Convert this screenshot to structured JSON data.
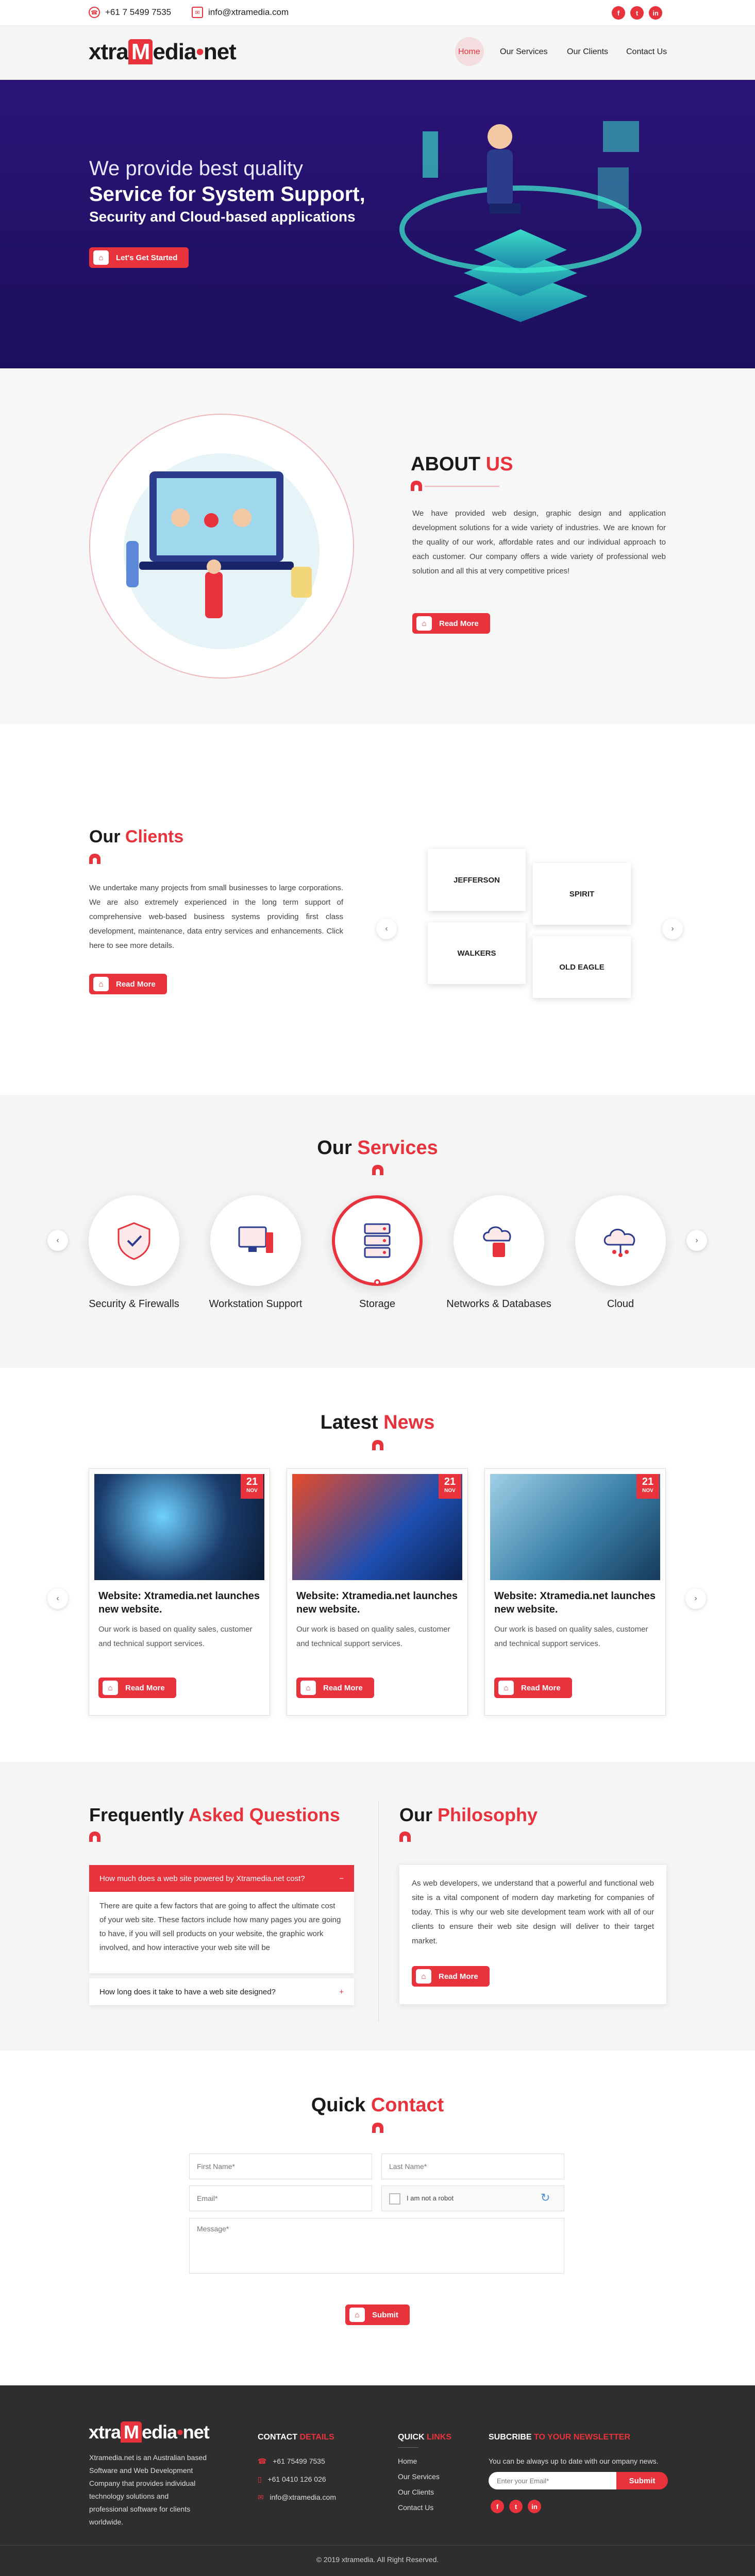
{
  "topbar": {
    "phone": "+61 7 5499 7535",
    "email": "info@xtramedia.com",
    "social": [
      "f",
      "t",
      "in"
    ]
  },
  "brand": {
    "pre": "xtra",
    "mark": "M",
    "post": "edia",
    "dot": "•",
    "tld": "net"
  },
  "nav": [
    "Home",
    "Our Services",
    "Our Clients",
    "Contact Us"
  ],
  "hero": {
    "line1": "We provide best quality",
    "line2": "Service for System Support,",
    "line3": "Security and Cloud-based applications",
    "cta": "Let's Get Started"
  },
  "about": {
    "title_a": "ABOUT",
    "title_b": "US",
    "text": "We have provided web design, graphic design and application development solutions for a wide variety of industries. We are known for the quality of our work, affordable rates and our individual approach to each customer. Our company offers a wide variety of professional web solution and all this at very competitive prices!",
    "button": "Read More"
  },
  "clients": {
    "title_a": "Our",
    "title_b": "Clients",
    "text": "We undertake many projects from small businesses to large corporations. We are also extremely experienced in the long term support of comprehensive web-based business systems providing first class development, maintenance, data entry services and enhancements. Click here to see more details.",
    "button": "Read More",
    "logos": [
      "JEFFERSON",
      "SPIRIT",
      "WALKERS",
      "OLD EAGLE"
    ]
  },
  "services": {
    "title_a": "Our",
    "title_b": "Services",
    "items": [
      "Security & Firewalls",
      "Workstation Support",
      "Storage",
      "Networks & Databases",
      "Cloud"
    ]
  },
  "news": {
    "title_a": "Latest",
    "title_b": "News",
    "cards": [
      {
        "day": "21",
        "month": "NOV",
        "title": "Website: Xtramedia.net launches new website.",
        "text": "Our work is based on quality sales, customer and technical support services.",
        "button": "Read More"
      },
      {
        "day": "21",
        "month": "NOV",
        "title": "Website: Xtramedia.net launches new website.",
        "text": "Our work is based on quality sales, customer and technical support services.",
        "button": "Read More"
      },
      {
        "day": "21",
        "month": "NOV",
        "title": "Website: Xtramedia.net launches new website.",
        "text": "Our work is based on quality sales, customer and technical support services.",
        "button": "Read More"
      }
    ]
  },
  "faq": {
    "title_a": "Frequently",
    "title_b": "Asked Questions",
    "q1": "How much does a web site powered by Xtramedia.net cost?",
    "a1": "There are quite a few factors that are going to affect the ultimate cost of your web site. These factors include how many pages you are going to have, if you will sell products on your website, the graphic work involved, and how interactive your web site will be",
    "q2": "How long does it take to have a web site designed?",
    "minus": "−",
    "plus": "+"
  },
  "philosophy": {
    "title_a": "Our",
    "title_b": "Philosophy",
    "text": "As web developers, we understand that a powerful and functional web site is a vital component of modern day marketing for companies of today. This is why our web site development team work with all of our clients to ensure their web site design will deliver to their target market.",
    "button": "Read More"
  },
  "contact": {
    "title_a": "Quick",
    "title_b": "Contact",
    "first": "First Name*",
    "last": "Last Name*",
    "email": "Email*",
    "robot": "I am not a robot",
    "message": "Message*",
    "submit": "Submit"
  },
  "footer": {
    "about": "Xtramedia.net is an Australian based Software and Web Development Company that provides individual technology solutions and professional software for clients worldwide.",
    "contact_a": "CONTACT",
    "contact_b": "DETAILS",
    "phone1": "+61 75499 7535",
    "phone2": "+61 0410 126 026",
    "email": "info@xtramedia.com",
    "links_a": "QUICK",
    "links_b": "LINKS",
    "links": [
      "Home",
      "Our Services",
      "Our Clients",
      "Contact Us"
    ],
    "news_a": "SUBCRIBE",
    "news_b": "TO YOUR NEWSLETTER",
    "news_text": "You can be always up to date with our ompany news.",
    "news_placeholder": "Enter your Email*",
    "news_button": "Submit",
    "copyright": "© 2019 xtramedia. All Right Reserved."
  },
  "colors": {
    "accent": "#e8323c",
    "hero": "#241268",
    "footer": "#2e2e2e"
  }
}
